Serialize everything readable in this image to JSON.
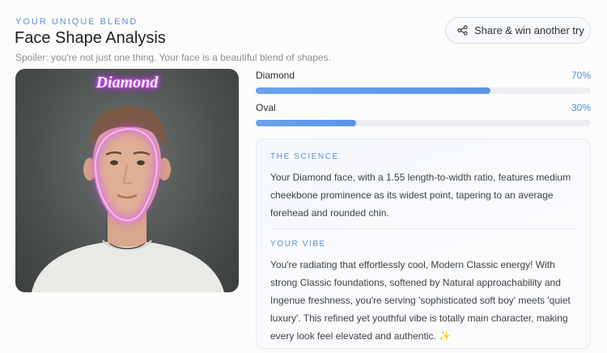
{
  "header": {
    "eyebrow": "YOUR UNIQUE BLEND",
    "title": "Face Shape Analysis",
    "subtitle": "Spoiler: you're not just one thing. Your face is a beautiful blend of shapes."
  },
  "share_button": {
    "label": "Share & win another try",
    "icon": "share-icon"
  },
  "photo": {
    "overlay_label": "Diamond",
    "outline_color": "#e05cff"
  },
  "blend": [
    {
      "name": "Diamond",
      "percent_label": "70%",
      "fraction": 0.7
    },
    {
      "name": "Oval",
      "percent_label": "30%",
      "fraction": 0.3
    }
  ],
  "science": {
    "label": "THE SCIENCE",
    "text": "Your Diamond face, with a 1.55 length-to-width ratio, features medium cheekbone prominence as its widest point, tapering to an average forehead and rounded chin."
  },
  "vibe": {
    "label": "YOUR VIBE",
    "text": "You're radiating that effortlessly cool, Modern Classic energy! With strong Classic foundations, softened by Natural approachability and Ingenue freshness, you're serving 'sophisticated soft boy' meets 'quiet luxury'. This refined yet youthful vibe is totally main character, making every look feel elevated and authentic. ✨"
  },
  "colors": {
    "accent": "#5b8fd6",
    "bar_fill": "#5a93e6",
    "neon": "#e05cff"
  }
}
